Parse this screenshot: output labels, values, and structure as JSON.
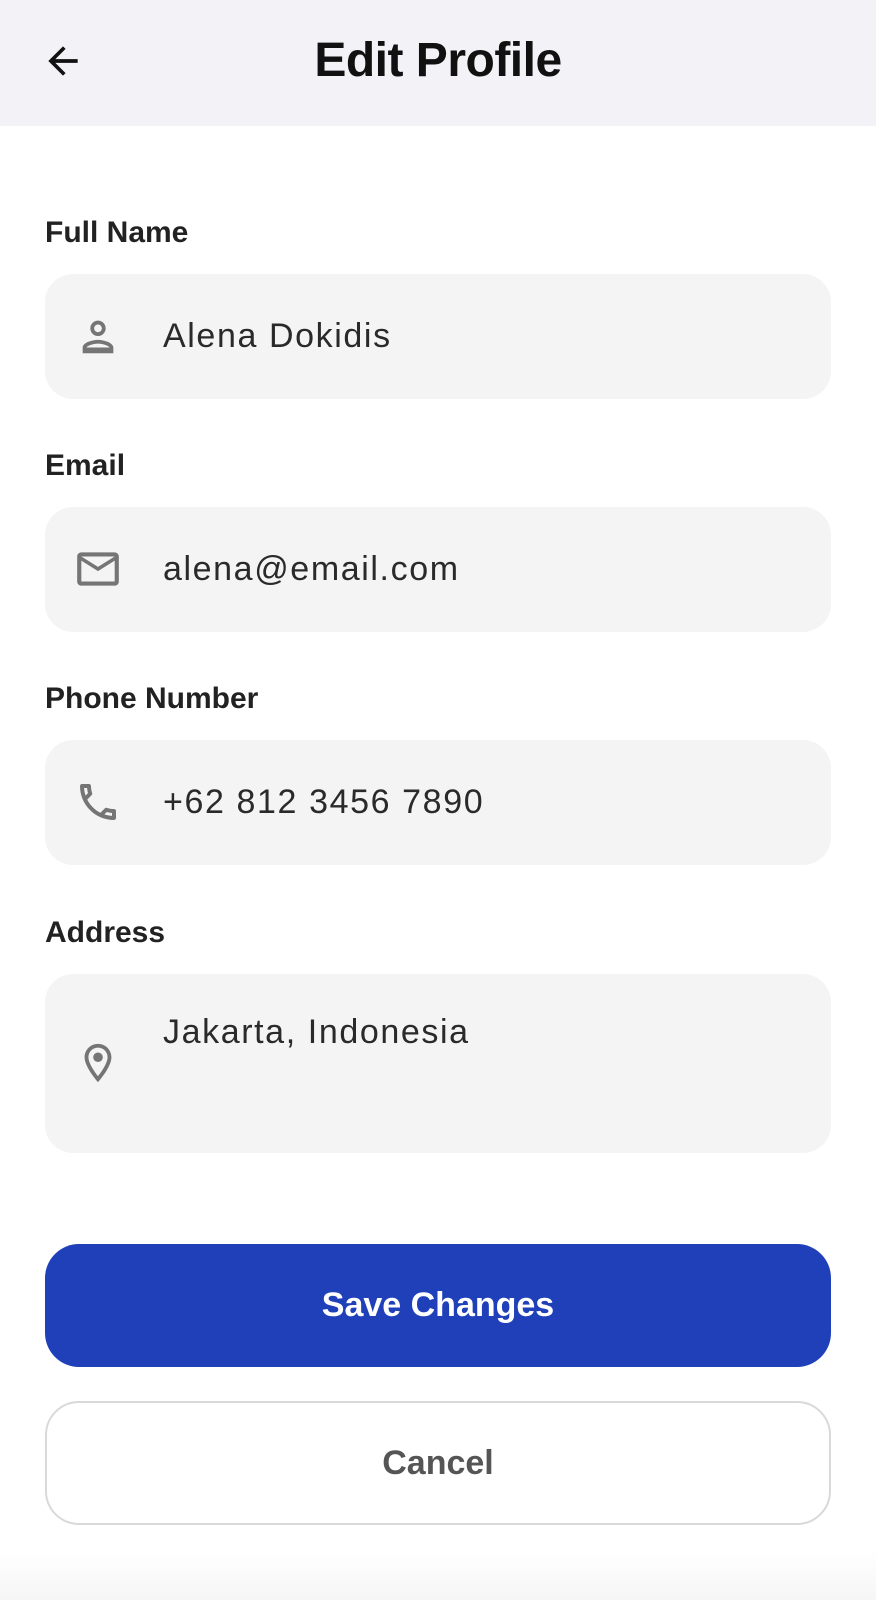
{
  "header": {
    "title": "Edit Profile",
    "back_icon": "arrow-left-icon"
  },
  "form": {
    "fields": [
      {
        "label": "Full Name",
        "value": "Alena Dokidis",
        "icon": "person-icon"
      },
      {
        "label": "Email",
        "value": "alena@email.com",
        "icon": "mail-icon"
      },
      {
        "label": "Phone Number",
        "value": "+62 812 3456 7890",
        "icon": "phone-icon"
      },
      {
        "label": "Address",
        "value": "Jakarta, Indonesia",
        "icon": "location-pin-icon"
      }
    ]
  },
  "actions": {
    "save_label": "Save Changes",
    "cancel_label": "Cancel"
  },
  "colors": {
    "primary": "#1f40b9",
    "header_bg": "#f2f2f7",
    "field_bg": "#f4f4f5",
    "icon": "#757575"
  }
}
